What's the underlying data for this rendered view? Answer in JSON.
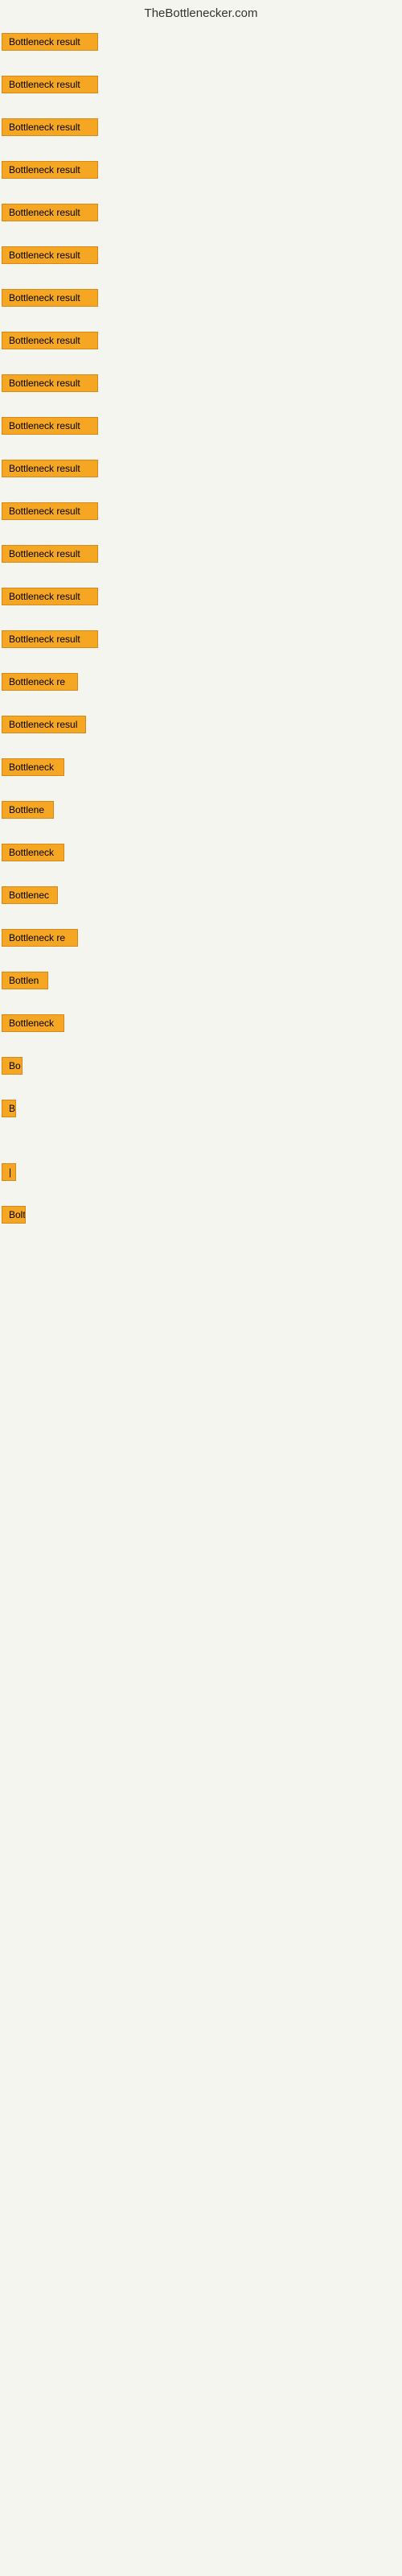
{
  "site": {
    "title": "TheBottlenecker.com"
  },
  "items": [
    {
      "label": "Bottleneck result",
      "width": 120
    },
    {
      "label": "Bottleneck result",
      "width": 120
    },
    {
      "label": "Bottleneck result",
      "width": 120
    },
    {
      "label": "Bottleneck result",
      "width": 120
    },
    {
      "label": "Bottleneck result",
      "width": 120
    },
    {
      "label": "Bottleneck result",
      "width": 120
    },
    {
      "label": "Bottleneck result",
      "width": 120
    },
    {
      "label": "Bottleneck result",
      "width": 120
    },
    {
      "label": "Bottleneck result",
      "width": 120
    },
    {
      "label": "Bottleneck result",
      "width": 120
    },
    {
      "label": "Bottleneck result",
      "width": 120
    },
    {
      "label": "Bottleneck result",
      "width": 120
    },
    {
      "label": "Bottleneck result",
      "width": 120
    },
    {
      "label": "Bottleneck result",
      "width": 120
    },
    {
      "label": "Bottleneck result",
      "width": 120
    },
    {
      "label": "Bottleneck re",
      "width": 95
    },
    {
      "label": "Bottleneck resul",
      "width": 105
    },
    {
      "label": "Bottleneck",
      "width": 78
    },
    {
      "label": "Bottlene",
      "width": 65
    },
    {
      "label": "Bottleneck",
      "width": 78
    },
    {
      "label": "Bottlenec",
      "width": 70
    },
    {
      "label": "Bottleneck re",
      "width": 95
    },
    {
      "label": "Bottlen",
      "width": 58
    },
    {
      "label": "Bottleneck",
      "width": 78
    },
    {
      "label": "Bo",
      "width": 26
    },
    {
      "label": "B",
      "width": 14
    },
    {
      "label": "",
      "width": 0
    },
    {
      "label": "|",
      "width": 8
    },
    {
      "label": "Bolt",
      "width": 30
    },
    {
      "label": "",
      "width": 0
    },
    {
      "label": "",
      "width": 0
    },
    {
      "label": "",
      "width": 0
    },
    {
      "label": "",
      "width": 0
    },
    {
      "label": "",
      "width": 0
    }
  ]
}
